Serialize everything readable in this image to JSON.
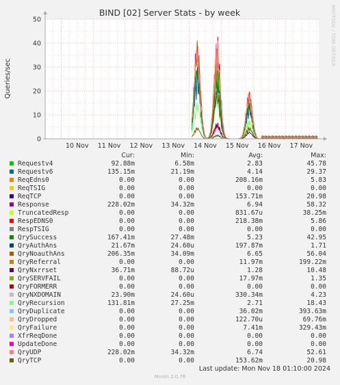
{
  "chart_data": {
    "type": "line",
    "title": "BIND [02] Server Stats - by week",
    "ylabel": "Queries/sec",
    "watermark": "RRDTOOL / TOBI OETIKER",
    "ylim": [
      0,
      50
    ],
    "yticks": [
      "0",
      "10",
      "20",
      "30",
      "40",
      "50"
    ],
    "xlim": [
      "2024-11-09T12:00",
      "2024-11-18T01:10"
    ],
    "xticks": [
      {
        "label": "10 Nov",
        "at": "2024-11-10T00:00"
      },
      {
        "label": "11 Nov",
        "at": "2024-11-11T00:00"
      },
      {
        "label": "12 Nov",
        "at": "2024-11-12T00:00"
      },
      {
        "label": "13 Nov",
        "at": "2024-11-13T00:00"
      },
      {
        "label": "14 Nov",
        "at": "2024-11-14T00:00"
      },
      {
        "label": "15 Nov",
        "at": "2024-11-15T00:00"
      },
      {
        "label": "16 Nov",
        "at": "2024-11-16T00:00"
      },
      {
        "label": "17 Nov",
        "at": "2024-11-17T00:00"
      }
    ],
    "grid": true,
    "legend_position": "bottom",
    "colors": {
      "background": "#f2f2f2",
      "plot_background": "#ffffff",
      "major_grid": "#ff9c9c",
      "minor_grid": "#e3c3c3",
      "axis": "#aaaaaa",
      "text": "#333333"
    },
    "series": [
      {
        "name": "Requestv4",
        "color": "#00cc00",
        "peaks": [
          {
            "t": "2024-11-14T06:00",
            "y": 32
          },
          {
            "t": "2024-11-14T21:00",
            "y": 35
          },
          {
            "t": "2024-11-15T21:00",
            "y": 15
          }
        ]
      },
      {
        "name": "Requestv6",
        "color": "#0066b3",
        "peaks": [
          {
            "t": "2024-11-14T06:00",
            "y": 30
          },
          {
            "t": "2024-11-14T21:00",
            "y": 24
          },
          {
            "t": "2024-11-15T21:00",
            "y": 15
          }
        ]
      },
      {
        "name": "ReqEdns0",
        "color": "#ff8000",
        "peaks": [
          {
            "t": "2024-11-14T21:00",
            "y": 5.8
          }
        ]
      },
      {
        "name": "ReqTSIG",
        "color": "#ffcc00",
        "peaks": []
      },
      {
        "name": "ReqTCP",
        "color": "#330099",
        "peaks": [
          {
            "t": "2024-11-14T21:00",
            "y": 20
          },
          {
            "t": "2024-11-15T21:00",
            "y": 5
          }
        ]
      },
      {
        "name": "Response",
        "color": "#990099",
        "peaks": [
          {
            "t": "2024-11-14T06:00",
            "y": 43
          },
          {
            "t": "2024-11-14T21:00",
            "y": 44
          },
          {
            "t": "2024-11-15T21:00",
            "y": 21
          }
        ]
      },
      {
        "name": "TruncatedResp",
        "color": "#ccff00",
        "peaks": [
          {
            "t": "2024-11-14T21:00",
            "y": 38
          },
          {
            "t": "2024-11-15T21:00",
            "y": 8
          }
        ]
      },
      {
        "name": "RespEDNS0",
        "color": "#ff0000",
        "peaks": [
          {
            "t": "2024-11-14T21:00",
            "y": 5.9
          }
        ]
      },
      {
        "name": "RespTSIG",
        "color": "#808080",
        "peaks": []
      },
      {
        "name": "QrySuccess",
        "color": "#008f00",
        "peaks": [
          {
            "t": "2024-11-14T06:00",
            "y": 33
          },
          {
            "t": "2024-11-14T21:00",
            "y": 30
          },
          {
            "t": "2024-11-15T21:00",
            "y": 16
          }
        ]
      },
      {
        "name": "QryAuthAns",
        "color": "#00487d",
        "peaks": [
          {
            "t": "2024-11-14T21:00",
            "y": 1.7
          }
        ]
      },
      {
        "name": "QryNoauthAns",
        "color": "#b35a00",
        "peaks": [
          {
            "t": "2024-11-14T06:00",
            "y": 42
          },
          {
            "t": "2024-11-14T21:00",
            "y": 39
          },
          {
            "t": "2024-11-15T21:00",
            "y": 20
          }
        ]
      },
      {
        "name": "QryReferral",
        "color": "#b38f00",
        "peaks": []
      },
      {
        "name": "QryNxrrset",
        "color": "#6b006b",
        "peaks": [
          {
            "t": "2024-11-14T21:00",
            "y": 7
          },
          {
            "t": "2024-11-15T21:00",
            "y": 3
          }
        ]
      },
      {
        "name": "QrySERVFAIL",
        "color": "#8fb300",
        "peaks": [
          {
            "t": "2024-11-14T21:00",
            "y": 1.3
          }
        ]
      },
      {
        "name": "QryFORMERR",
        "color": "#b30000",
        "peaks": []
      },
      {
        "name": "QryNXDOMAIN",
        "color": "#bebebe",
        "peaks": [
          {
            "t": "2024-11-14T21:00",
            "y": 4.2
          }
        ]
      },
      {
        "name": "QryRecursion",
        "color": "#80ff80",
        "peaks": [
          {
            "t": "2024-11-14T06:00",
            "y": 16
          },
          {
            "t": "2024-11-14T21:00",
            "y": 18
          },
          {
            "t": "2024-11-15T21:00",
            "y": 8
          }
        ]
      },
      {
        "name": "QryDuplicate",
        "color": "#80c9ff",
        "peaks": []
      },
      {
        "name": "QryDropped",
        "color": "#ffc080",
        "peaks": []
      },
      {
        "name": "QryFailure",
        "color": "#ffe680",
        "peaks": []
      },
      {
        "name": "XfrReqDone",
        "color": "#aa80ff",
        "peaks": []
      },
      {
        "name": "UpdateDone",
        "color": "#ee00cc",
        "peaks": []
      },
      {
        "name": "QryUDP",
        "color": "#ff8080",
        "peaks": [
          {
            "t": "2024-11-14T06:00",
            "y": 42
          },
          {
            "t": "2024-11-14T21:00",
            "y": 43
          },
          {
            "t": "2024-11-15T21:00",
            "y": 21
          }
        ]
      },
      {
        "name": "QryTCP",
        "color": "#666600",
        "peaks": [
          {
            "t": "2024-11-14T06:00",
            "y": 5
          },
          {
            "t": "2024-11-14T21:00",
            "y": 21
          },
          {
            "t": "2024-11-15T21:00",
            "y": 5
          }
        ]
      }
    ]
  },
  "legend": {
    "headers": {
      "cur": "Cur:",
      "min": "Min:",
      "avg": "Avg:",
      "max": "Max:"
    },
    "rows": [
      {
        "name": "Requestv4",
        "color": "#00cc00",
        "cur": "92.88m",
        "min": "6.58m",
        "avg": "2.83",
        "max": "45.78"
      },
      {
        "name": "Requestv6",
        "color": "#0066b3",
        "cur": "135.15m",
        "min": "21.19m",
        "avg": "4.14",
        "max": "29.37"
      },
      {
        "name": "ReqEdns0",
        "color": "#ff8000",
        "cur": "0.00",
        "min": "0.00",
        "avg": "208.16m",
        "max": "5.83"
      },
      {
        "name": "ReqTSIG",
        "color": "#ffcc00",
        "cur": "0.00",
        "min": "0.00",
        "avg": "0.00",
        "max": "0.00"
      },
      {
        "name": "ReqTCP",
        "color": "#330099",
        "cur": "0.00",
        "min": "0.00",
        "avg": "153.71m",
        "max": "20.98"
      },
      {
        "name": "Response",
        "color": "#990099",
        "cur": "228.02m",
        "min": "34.32m",
        "avg": "6.94",
        "max": "58.32"
      },
      {
        "name": "TruncatedResp",
        "color": "#ccff00",
        "cur": "0.00",
        "min": "0.00",
        "avg": "831.67u",
        "max": "38.25m"
      },
      {
        "name": "RespEDNS0",
        "color": "#ff0000",
        "cur": "0.00",
        "min": "0.00",
        "avg": "218.38m",
        "max": "5.86"
      },
      {
        "name": "RespTSIG",
        "color": "#808080",
        "cur": "0.00",
        "min": "0.00",
        "avg": "0.00",
        "max": "0.00"
      },
      {
        "name": "QrySuccess",
        "color": "#008f00",
        "cur": "167.41m",
        "min": "27.48m",
        "avg": "5.23",
        "max": "42.95"
      },
      {
        "name": "QryAuthAns",
        "color": "#00487d",
        "cur": "21.67m",
        "min": "24.60u",
        "avg": "197.87m",
        "max": "1.71"
      },
      {
        "name": "QryNoauthAns",
        "color": "#b35a00",
        "cur": "206.35m",
        "min": "34.09m",
        "avg": "6.65",
        "max": "56.04"
      },
      {
        "name": "QryReferral",
        "color": "#b38f00",
        "cur": "0.00",
        "min": "0.00",
        "avg": "11.97m",
        "max": "199.22m"
      },
      {
        "name": "QryNxrrset",
        "color": "#6b006b",
        "cur": "36.71m",
        "min": "88.72u",
        "avg": "1.28",
        "max": "10.48"
      },
      {
        "name": "QrySERVFAIL",
        "color": "#8fb300",
        "cur": "0.00",
        "min": "0.00",
        "avg": "17.97m",
        "max": "1.35"
      },
      {
        "name": "QryFORMERR",
        "color": "#b30000",
        "cur": "0.00",
        "min": "0.00",
        "avg": "0.00",
        "max": "0.00"
      },
      {
        "name": "QryNXDOMAIN",
        "color": "#bebebe",
        "cur": "23.90m",
        "min": "24.60u",
        "avg": "330.34m",
        "max": "4.23"
      },
      {
        "name": "QryRecursion",
        "color": "#80ff80",
        "cur": "131.81m",
        "min": "27.25m",
        "avg": "2.71",
        "max": "18.43"
      },
      {
        "name": "QryDuplicate",
        "color": "#80c9ff",
        "cur": "0.00",
        "min": "0.00",
        "avg": "36.02m",
        "max": "393.63m"
      },
      {
        "name": "QryDropped",
        "color": "#ffc080",
        "cur": "0.00",
        "min": "0.00",
        "avg": "122.70u",
        "max": "69.76m"
      },
      {
        "name": "QryFailure",
        "color": "#ffe680",
        "cur": "0.00",
        "min": "0.00",
        "avg": "7.41m",
        "max": "329.43m"
      },
      {
        "name": "XfrReqDone",
        "color": "#aa80ff",
        "cur": "0.00",
        "min": "0.00",
        "avg": "0.00",
        "max": "0.00"
      },
      {
        "name": "UpdateDone",
        "color": "#ee00cc",
        "cur": "0.00",
        "min": "0.00",
        "avg": "0.00",
        "max": "0.00"
      },
      {
        "name": "QryUDP",
        "color": "#ff8080",
        "cur": "228.02m",
        "min": "34.32m",
        "avg": "6.74",
        "max": "52.61"
      },
      {
        "name": "QryTCP",
        "color": "#666600",
        "cur": "0.00",
        "min": "0.00",
        "avg": "153.62m",
        "max": "20.98"
      }
    ]
  },
  "footer": {
    "last_update": "Last update: Mon Nov 18 01:10:00 2024",
    "version": "Munin 2.0.76"
  }
}
